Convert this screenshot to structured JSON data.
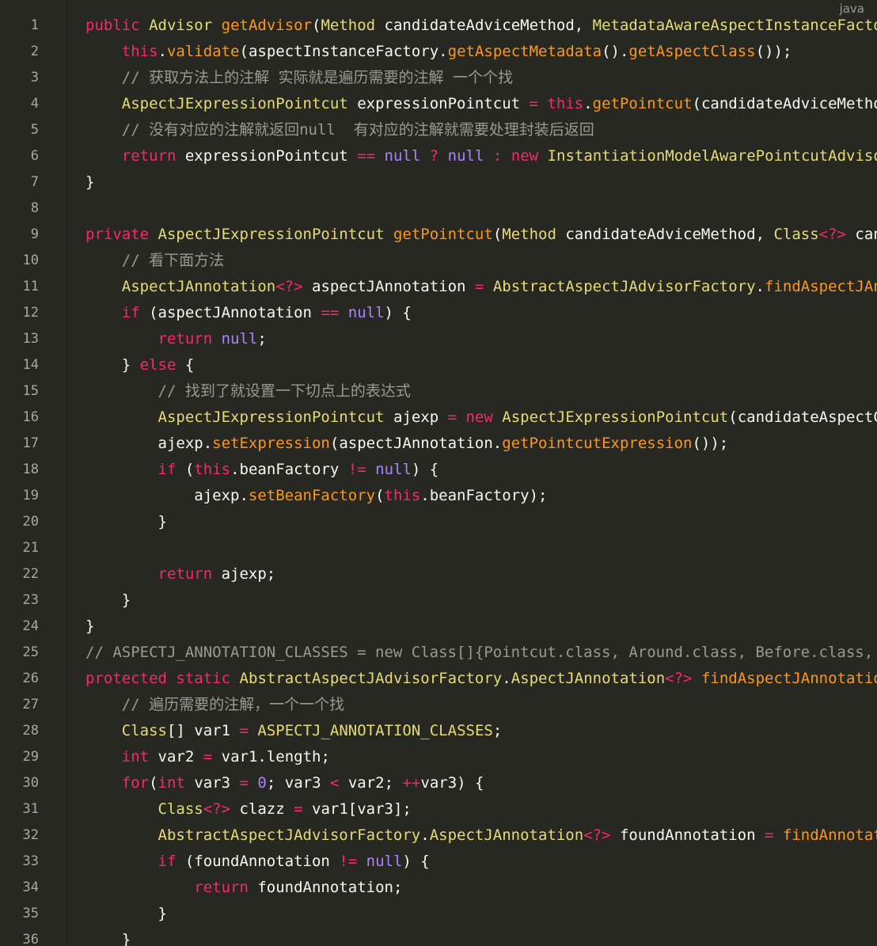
{
  "language_label": "java",
  "colors": {
    "background": "#272822",
    "keyword": "#f92672",
    "type": "#e6db74",
    "method": "#fd971f",
    "comment": "#9a9a93",
    "literal": "#ae81ff",
    "text": "#f8f8f2"
  },
  "lines": [
    {
      "n": "1",
      "tokens": [
        [
          "keyword",
          "public"
        ],
        [
          "plain",
          " "
        ],
        [
          "type",
          "Advisor"
        ],
        [
          "plain",
          " "
        ],
        [
          "method",
          "getAdvisor"
        ],
        [
          "punc",
          "("
        ],
        [
          "type",
          "Method"
        ],
        [
          "plain",
          " candidateAdviceMethod, "
        ],
        [
          "type",
          "MetadataAwareAspectInstanceFactory"
        ]
      ]
    },
    {
      "n": "2",
      "tokens": [
        [
          "plain",
          "    "
        ],
        [
          "keyword",
          "this"
        ],
        [
          "punc",
          "."
        ],
        [
          "method",
          "validate"
        ],
        [
          "punc",
          "("
        ],
        [
          "plain",
          "aspectInstanceFactory."
        ],
        [
          "method",
          "getAspectMetadata"
        ],
        [
          "punc",
          "()."
        ],
        [
          "method",
          "getAspectClass"
        ],
        [
          "punc",
          "());"
        ]
      ]
    },
    {
      "n": "3",
      "tokens": [
        [
          "plain",
          "    "
        ],
        [
          "comment",
          "// 获取方法上的注解 实际就是遍历需要的注解 一个个找"
        ]
      ]
    },
    {
      "n": "4",
      "tokens": [
        [
          "plain",
          "    "
        ],
        [
          "type",
          "AspectJExpressionPointcut"
        ],
        [
          "plain",
          " expressionPointcut "
        ],
        [
          "op",
          "="
        ],
        [
          "plain",
          " "
        ],
        [
          "keyword",
          "this"
        ],
        [
          "punc",
          "."
        ],
        [
          "method",
          "getPointcut"
        ],
        [
          "punc",
          "("
        ],
        [
          "plain",
          "candidateAdviceMethod"
        ]
      ]
    },
    {
      "n": "5",
      "tokens": [
        [
          "plain",
          "    "
        ],
        [
          "comment",
          "// 没有对应的注解就返回null  有对应的注解就需要处理封装后返回"
        ]
      ]
    },
    {
      "n": "6",
      "tokens": [
        [
          "plain",
          "    "
        ],
        [
          "keyword",
          "return"
        ],
        [
          "plain",
          " expressionPointcut "
        ],
        [
          "op",
          "=="
        ],
        [
          "plain",
          " "
        ],
        [
          "literal",
          "null"
        ],
        [
          "plain",
          " "
        ],
        [
          "op",
          "?"
        ],
        [
          "plain",
          " "
        ],
        [
          "literal",
          "null"
        ],
        [
          "plain",
          " "
        ],
        [
          "op",
          ":"
        ],
        [
          "plain",
          " "
        ],
        [
          "keyword",
          "new"
        ],
        [
          "plain",
          " "
        ],
        [
          "type",
          "InstantiationModelAwarePointcutAdvisor"
        ]
      ]
    },
    {
      "n": "7",
      "tokens": [
        [
          "punc",
          "}"
        ]
      ]
    },
    {
      "n": "8",
      "tokens": []
    },
    {
      "n": "9",
      "tokens": [
        [
          "keyword",
          "private"
        ],
        [
          "plain",
          " "
        ],
        [
          "type",
          "AspectJExpressionPointcut"
        ],
        [
          "plain",
          " "
        ],
        [
          "method",
          "getPointcut"
        ],
        [
          "punc",
          "("
        ],
        [
          "type",
          "Method"
        ],
        [
          "plain",
          " candidateAdviceMethod, "
        ],
        [
          "type",
          "Class"
        ],
        [
          "op",
          "<?>"
        ],
        [
          "plain",
          " cand"
        ]
      ]
    },
    {
      "n": "10",
      "tokens": [
        [
          "plain",
          "    "
        ],
        [
          "comment",
          "// 看下面方法"
        ]
      ]
    },
    {
      "n": "11",
      "tokens": [
        [
          "plain",
          "    "
        ],
        [
          "type",
          "AspectJAnnotation"
        ],
        [
          "op",
          "<?>"
        ],
        [
          "plain",
          " aspectJAnnotation "
        ],
        [
          "op",
          "="
        ],
        [
          "plain",
          " "
        ],
        [
          "type",
          "AbstractAspectJAdvisorFactory"
        ],
        [
          "punc",
          "."
        ],
        [
          "method",
          "findAspectJAnno"
        ]
      ]
    },
    {
      "n": "12",
      "tokens": [
        [
          "plain",
          "    "
        ],
        [
          "keyword",
          "if"
        ],
        [
          "plain",
          " (aspectJAnnotation "
        ],
        [
          "op",
          "=="
        ],
        [
          "plain",
          " "
        ],
        [
          "literal",
          "null"
        ],
        [
          "plain",
          ") {"
        ]
      ]
    },
    {
      "n": "13",
      "tokens": [
        [
          "plain",
          "        "
        ],
        [
          "keyword",
          "return"
        ],
        [
          "plain",
          " "
        ],
        [
          "literal",
          "null"
        ],
        [
          "punc",
          ";"
        ]
      ]
    },
    {
      "n": "14",
      "tokens": [
        [
          "plain",
          "    } "
        ],
        [
          "keyword",
          "else"
        ],
        [
          "plain",
          " {"
        ]
      ]
    },
    {
      "n": "15",
      "tokens": [
        [
          "plain",
          "        "
        ],
        [
          "comment",
          "// 找到了就设置一下切点上的表达式"
        ]
      ]
    },
    {
      "n": "16",
      "tokens": [
        [
          "plain",
          "        "
        ],
        [
          "type",
          "AspectJExpressionPointcut"
        ],
        [
          "plain",
          " ajexp "
        ],
        [
          "op",
          "="
        ],
        [
          "plain",
          " "
        ],
        [
          "keyword",
          "new"
        ],
        [
          "plain",
          " "
        ],
        [
          "type",
          "AspectJExpressionPointcut"
        ],
        [
          "punc",
          "("
        ],
        [
          "plain",
          "candidateAspectCla"
        ]
      ]
    },
    {
      "n": "17",
      "tokens": [
        [
          "plain",
          "        ajexp."
        ],
        [
          "method",
          "setExpression"
        ],
        [
          "punc",
          "("
        ],
        [
          "plain",
          "aspectJAnnotation."
        ],
        [
          "method",
          "getPointcutExpression"
        ],
        [
          "punc",
          "());"
        ]
      ]
    },
    {
      "n": "18",
      "tokens": [
        [
          "plain",
          "        "
        ],
        [
          "keyword",
          "if"
        ],
        [
          "plain",
          " ("
        ],
        [
          "keyword",
          "this"
        ],
        [
          "plain",
          ".beanFactory "
        ],
        [
          "op",
          "!="
        ],
        [
          "plain",
          " "
        ],
        [
          "literal",
          "null"
        ],
        [
          "plain",
          ") {"
        ]
      ]
    },
    {
      "n": "19",
      "tokens": [
        [
          "plain",
          "            ajexp."
        ],
        [
          "method",
          "setBeanFactory"
        ],
        [
          "punc",
          "("
        ],
        [
          "keyword",
          "this"
        ],
        [
          "plain",
          ".beanFactory);"
        ]
      ]
    },
    {
      "n": "20",
      "tokens": [
        [
          "plain",
          "        }"
        ]
      ]
    },
    {
      "n": "21",
      "tokens": []
    },
    {
      "n": "22",
      "tokens": [
        [
          "plain",
          "        "
        ],
        [
          "keyword",
          "return"
        ],
        [
          "plain",
          " ajexp;"
        ]
      ]
    },
    {
      "n": "23",
      "tokens": [
        [
          "plain",
          "    }"
        ]
      ]
    },
    {
      "n": "24",
      "tokens": [
        [
          "punc",
          "}"
        ]
      ]
    },
    {
      "n": "25",
      "tokens": [
        [
          "comment",
          "// ASPECTJ_ANNOTATION_CLASSES = new Class[]{Pointcut.class, Around.class, Before.class, A"
        ]
      ]
    },
    {
      "n": "26",
      "tokens": [
        [
          "keyword",
          "protected"
        ],
        [
          "plain",
          " "
        ],
        [
          "keyword",
          "static"
        ],
        [
          "plain",
          " "
        ],
        [
          "type",
          "AbstractAspectJAdvisorFactory"
        ],
        [
          "punc",
          "."
        ],
        [
          "type",
          "AspectJAnnotation"
        ],
        [
          "op",
          "<?>"
        ],
        [
          "plain",
          " "
        ],
        [
          "method",
          "findAspectJAnnotation"
        ]
      ]
    },
    {
      "n": "27",
      "tokens": [
        [
          "plain",
          "    "
        ],
        [
          "comment",
          "// 遍历需要的注解，一个一个找"
        ]
      ]
    },
    {
      "n": "28",
      "tokens": [
        [
          "plain",
          "    "
        ],
        [
          "type",
          "Class"
        ],
        [
          "punc",
          "[]"
        ],
        [
          "plain",
          " var1 "
        ],
        [
          "op",
          "="
        ],
        [
          "plain",
          " "
        ],
        [
          "type",
          "ASPECTJ_ANNOTATION_CLASSES"
        ],
        [
          "punc",
          ";"
        ]
      ]
    },
    {
      "n": "29",
      "tokens": [
        [
          "plain",
          "    "
        ],
        [
          "keyword",
          "int"
        ],
        [
          "plain",
          " var2 "
        ],
        [
          "op",
          "="
        ],
        [
          "plain",
          " var1.length;"
        ]
      ]
    },
    {
      "n": "30",
      "tokens": [
        [
          "plain",
          "    "
        ],
        [
          "keyword",
          "for"
        ],
        [
          "punc",
          "("
        ],
        [
          "keyword",
          "int"
        ],
        [
          "plain",
          " var3 "
        ],
        [
          "op",
          "="
        ],
        [
          "plain",
          " "
        ],
        [
          "number",
          "0"
        ],
        [
          "plain",
          "; var3 "
        ],
        [
          "op",
          "<"
        ],
        [
          "plain",
          " var2; "
        ],
        [
          "op",
          "++"
        ],
        [
          "plain",
          "var3) {"
        ]
      ]
    },
    {
      "n": "31",
      "tokens": [
        [
          "plain",
          "        "
        ],
        [
          "type",
          "Class"
        ],
        [
          "op",
          "<?>"
        ],
        [
          "plain",
          " clazz "
        ],
        [
          "op",
          "="
        ],
        [
          "plain",
          " var1[var3];"
        ]
      ]
    },
    {
      "n": "32",
      "tokens": [
        [
          "plain",
          "        "
        ],
        [
          "type",
          "AbstractAspectJAdvisorFactory"
        ],
        [
          "punc",
          "."
        ],
        [
          "type",
          "AspectJAnnotation"
        ],
        [
          "op",
          "<?>"
        ],
        [
          "plain",
          " foundAnnotation "
        ],
        [
          "op",
          "="
        ],
        [
          "plain",
          " "
        ],
        [
          "method",
          "findAnnotatio"
        ]
      ]
    },
    {
      "n": "33",
      "tokens": [
        [
          "plain",
          "        "
        ],
        [
          "keyword",
          "if"
        ],
        [
          "plain",
          " (foundAnnotation "
        ],
        [
          "op",
          "!="
        ],
        [
          "plain",
          " "
        ],
        [
          "literal",
          "null"
        ],
        [
          "plain",
          ") {"
        ]
      ]
    },
    {
      "n": "34",
      "tokens": [
        [
          "plain",
          "            "
        ],
        [
          "keyword",
          "return"
        ],
        [
          "plain",
          " foundAnnotation;"
        ]
      ]
    },
    {
      "n": "35",
      "tokens": [
        [
          "plain",
          "        }"
        ]
      ]
    },
    {
      "n": "36",
      "tokens": [
        [
          "plain",
          "    }"
        ]
      ]
    }
  ]
}
